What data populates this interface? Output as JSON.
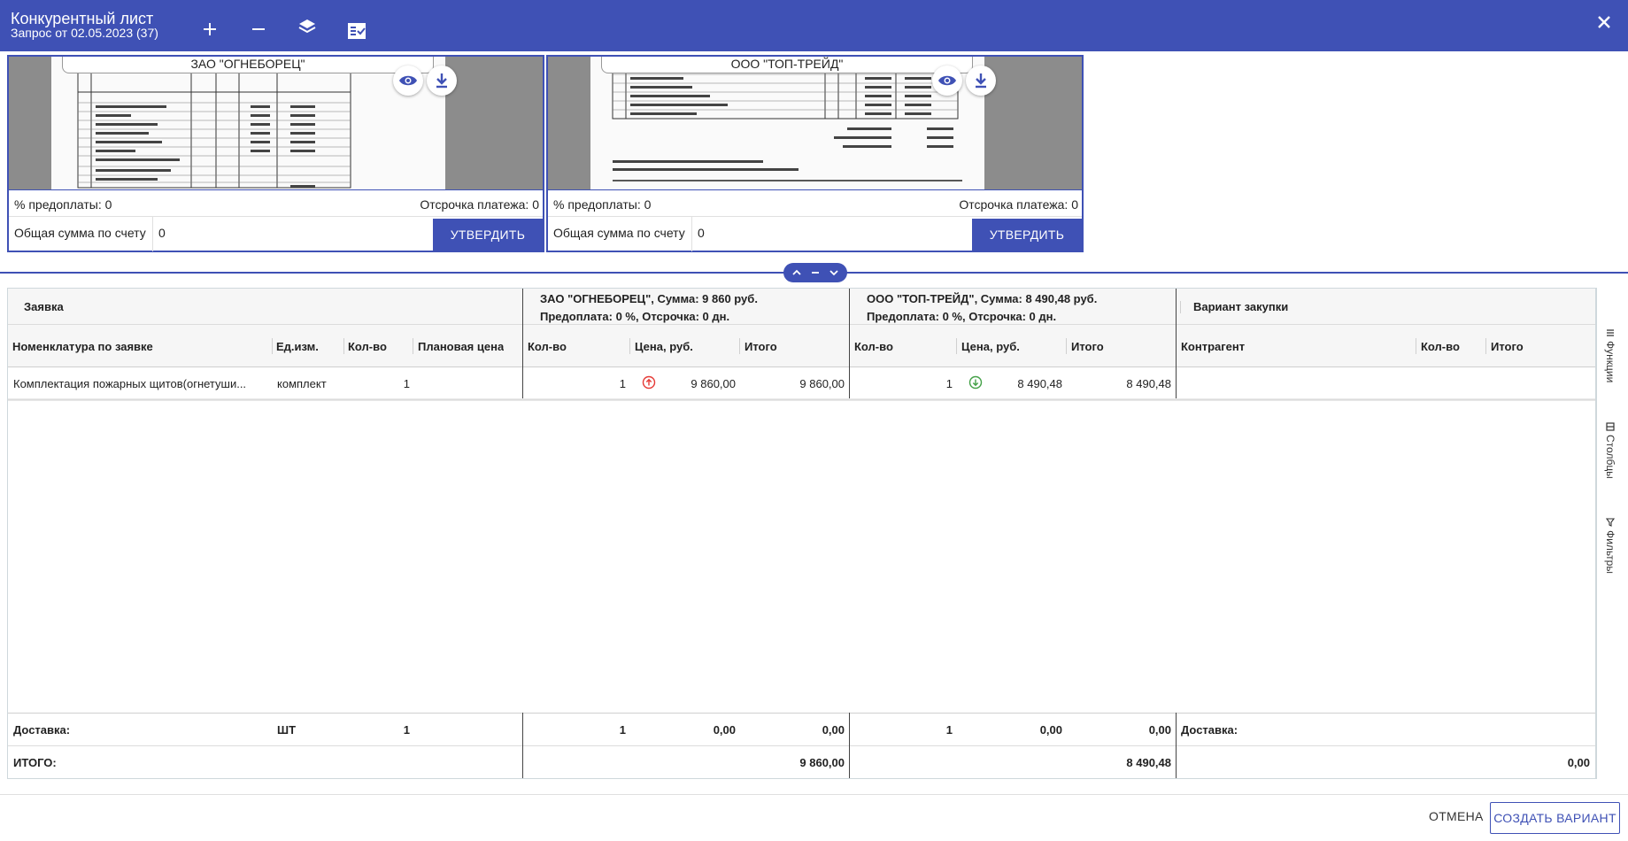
{
  "header": {
    "title": "Конкурентный лист",
    "subtitle": "Запрос от 02.05.2023 (37)",
    "icons": [
      "plus-icon",
      "minus-icon",
      "layers-icon",
      "checklist-icon",
      "close-icon"
    ]
  },
  "suppliers": [
    {
      "name": "ЗАО \"ОГНЕБОРЕЦ\"",
      "prepay_label": "% предоплаты: 0",
      "delay_label": "Отсрочка платежа: 0",
      "total_label": "Общая сумма по счету",
      "total_value": "0",
      "approve_label": "УТВЕРДИТЬ"
    },
    {
      "name": "ООО \"ТОП-ТРЕЙД\"",
      "prepay_label": "% предоплаты: 0",
      "delay_label": "Отсрочка платежа: 0",
      "total_label": "Общая сумма по счету",
      "total_value": "0",
      "approve_label": "УТВЕРДИТЬ"
    }
  ],
  "table": {
    "group_request": "Заявка",
    "group_s1_line1": "ЗАО \"ОГНЕБОРЕЦ\", Сумма: 9 860 руб.",
    "group_s1_line2": "Предоплата: 0 %, Отсрочка: 0 дн.",
    "group_s2_line1": "ООО \"ТОП-ТРЕЙД\", Сумма: 8 490,48 руб.",
    "group_s2_line2": "Предоплата: 0 %, Отсрочка: 0 дн.",
    "group_variant": "Вариант закупки",
    "col_nomenclature": "Номенклатура по заявке",
    "col_unit": "Ед.изм.",
    "col_qty": "Кол-во",
    "col_plan_price": "Плановая цена",
    "col_s1_qty": "Кол-во",
    "col_s1_price": "Цена, руб.",
    "col_s1_total": "Итого",
    "col_s2_qty": "Кол-во",
    "col_s2_price": "Цена, руб.",
    "col_s2_total": "Итого",
    "col_v_contractor": "Контрагент",
    "col_v_qty": "Кол-во",
    "col_v_total": "Итого",
    "row": {
      "nomenclature": "Комплектация пожарных щитов(огнетуши...",
      "unit": "комплект",
      "qty": "1",
      "s1_qty": "1",
      "s1_price": "9 860,00",
      "s1_total": "9 860,00",
      "s2_qty": "1",
      "s2_price": "8 490,48",
      "s2_total": "8 490,48"
    },
    "delivery": {
      "label": "Доставка:",
      "unit": "ШТ",
      "qty": "1",
      "s1_qty": "1",
      "s1_price": "0,00",
      "s1_total": "0,00",
      "s2_qty": "1",
      "s2_price": "0,00",
      "s2_total": "0,00",
      "v_label": "Доставка:"
    },
    "total": {
      "label": "ИТОГО:",
      "s1_total": "9 860,00",
      "s2_total": "8 490,48",
      "v_total": "0,00"
    }
  },
  "side_panel": {
    "functions": "Функции",
    "columns": "Столбцы",
    "filters": "Фильтры"
  },
  "footer": {
    "cancel": "ОТМЕНА",
    "create": "СОЗДАТЬ ВАРИАНТ"
  },
  "colors": {
    "accent": "#3f51b5",
    "price_up": "#e53935",
    "price_down": "#43a047"
  }
}
